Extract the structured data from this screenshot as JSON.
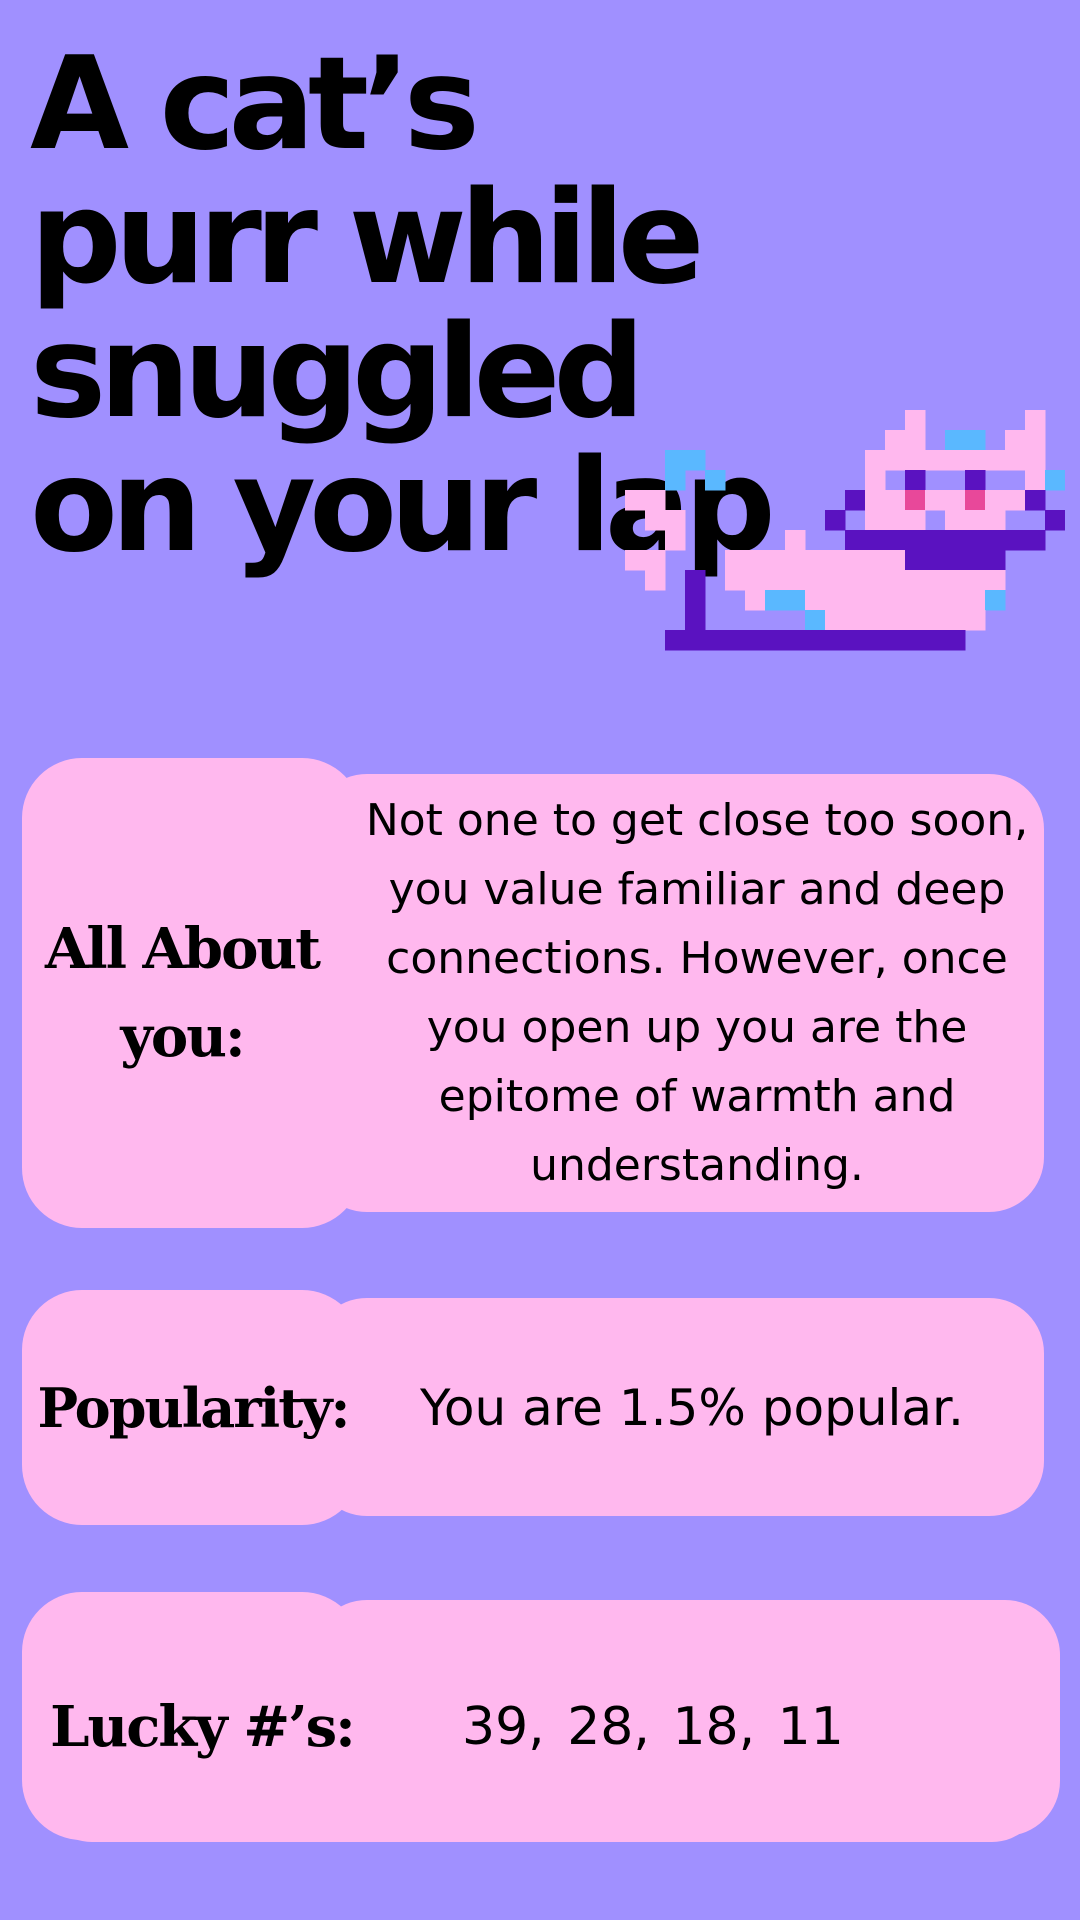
{
  "title": "A cat’s purr while snuggled on your lap",
  "colors": {
    "background": "#a090ff",
    "card": "#ffb8ee",
    "cat_body": "#ffb8ee",
    "cat_outline": "#5a12c0",
    "cat_highlight": "#5ab8ff",
    "cat_eye": "#e8489a"
  },
  "illustration": {
    "icon": "pixel-cat-icon"
  },
  "about": {
    "label": "All About you:",
    "text": "Not one to get close too soon, you value familiar and deep connections. However, once you open up you are the epitome of warmth and understanding."
  },
  "popularity": {
    "label": "Popularity:",
    "text": "You are 1.5% popular."
  },
  "lucky": {
    "label": "Lucky #’s:",
    "text": "39,  28,  18,  11"
  }
}
